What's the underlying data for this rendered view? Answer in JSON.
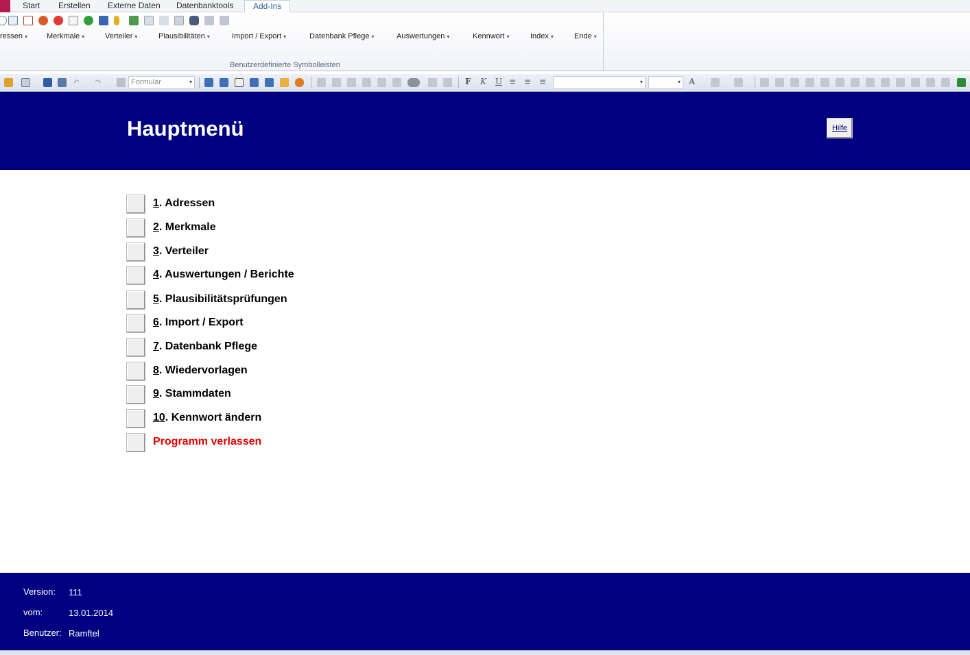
{
  "ribbon": {
    "tabs": [
      "Start",
      "Erstellen",
      "Externe Daten",
      "Datenbanktools",
      "Add-Ins"
    ],
    "active_tab": "Add-Ins",
    "menu_items": [
      "ressen",
      "Merkmale",
      "Verteiler",
      "Plausibilitäten",
      "Import / Export",
      "Datenbank Pflege",
      "Auswertungen",
      "Kennwort",
      "Index",
      "Ende"
    ],
    "group_label": "Benutzerdefinierte Symbolleisten"
  },
  "toolbar": {
    "object_combo": "Formular",
    "bold_glyph": "F",
    "italic_glyph": "K",
    "underline_glyph": "U",
    "font_color_glyph": "A"
  },
  "header": {
    "title": "Hauptmenü",
    "help_label": "Hilfe"
  },
  "main_menu": {
    "items": [
      {
        "num": "1",
        "rest": ". Adressen"
      },
      {
        "num": "2",
        "rest": ". Merkmale"
      },
      {
        "num": "3",
        "rest": ". Verteiler"
      },
      {
        "num": "4",
        "rest": ". Auswertungen / Berichte"
      },
      {
        "num": "5",
        "rest": ". Plausibilitätsprüfungen"
      },
      {
        "num": "6",
        "rest": ". Import / Export"
      },
      {
        "num": "7",
        "rest": ". Datenbank Pflege"
      },
      {
        "num": "8",
        "rest": ". Wiedervorlagen"
      },
      {
        "num": "9",
        "rest": ". Stammdaten"
      },
      {
        "num": "10",
        "rest": ". Kennwort ändern"
      }
    ],
    "exit_label": "Programm verlassen"
  },
  "footer": {
    "version_label": "Version:",
    "version_value": "111",
    "date_label": "vom:",
    "date_value": "13.01.2014",
    "user_label": "Benutzer:",
    "user_value": "Ramftel"
  },
  "colors": {
    "band": "#000080",
    "exit": "#e00000"
  }
}
